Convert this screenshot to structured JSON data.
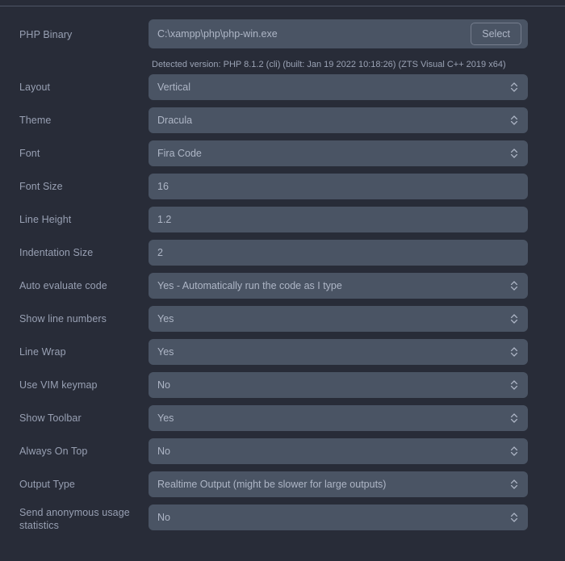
{
  "colors": {
    "page_background": "#282c38",
    "field_background": "#4a5464",
    "label_text": "#98a0b3",
    "value_text": "#aeb6c6",
    "divider": "#4d5565",
    "button_border": "#767e8e"
  },
  "php_binary": {
    "label": "PHP Binary",
    "value": "C:\\xampp\\php\\php-win.exe",
    "select_label": "Select",
    "detected_version": "Detected version: PHP 8.1.2 (cli) (built: Jan 19 2022 10:18:26) (ZTS Visual C++ 2019 x64)"
  },
  "rows": [
    {
      "label": "Layout",
      "value": "Vertical",
      "type": "select"
    },
    {
      "label": "Theme",
      "value": "Dracula",
      "type": "select"
    },
    {
      "label": "Font",
      "value": "Fira Code",
      "type": "select"
    },
    {
      "label": "Font Size",
      "value": "16",
      "type": "text"
    },
    {
      "label": "Line Height",
      "value": "1.2",
      "type": "text"
    },
    {
      "label": "Indentation Size",
      "value": "2",
      "type": "text"
    },
    {
      "label": "Auto evaluate code",
      "value": "Yes - Automatically run the code as I type",
      "type": "select"
    },
    {
      "label": "Show line numbers",
      "value": "Yes",
      "type": "select"
    },
    {
      "label": "Line Wrap",
      "value": "Yes",
      "type": "select"
    },
    {
      "label": "Use VIM keymap",
      "value": "No",
      "type": "select"
    },
    {
      "label": "Show Toolbar",
      "value": "Yes",
      "type": "select"
    },
    {
      "label": "Always On Top",
      "value": "No",
      "type": "select"
    },
    {
      "label": "Output Type",
      "value": "Realtime Output (might be slower for large outputs)",
      "type": "select"
    },
    {
      "label": "Send anonymous usage statistics",
      "value": "No",
      "type": "select"
    }
  ]
}
